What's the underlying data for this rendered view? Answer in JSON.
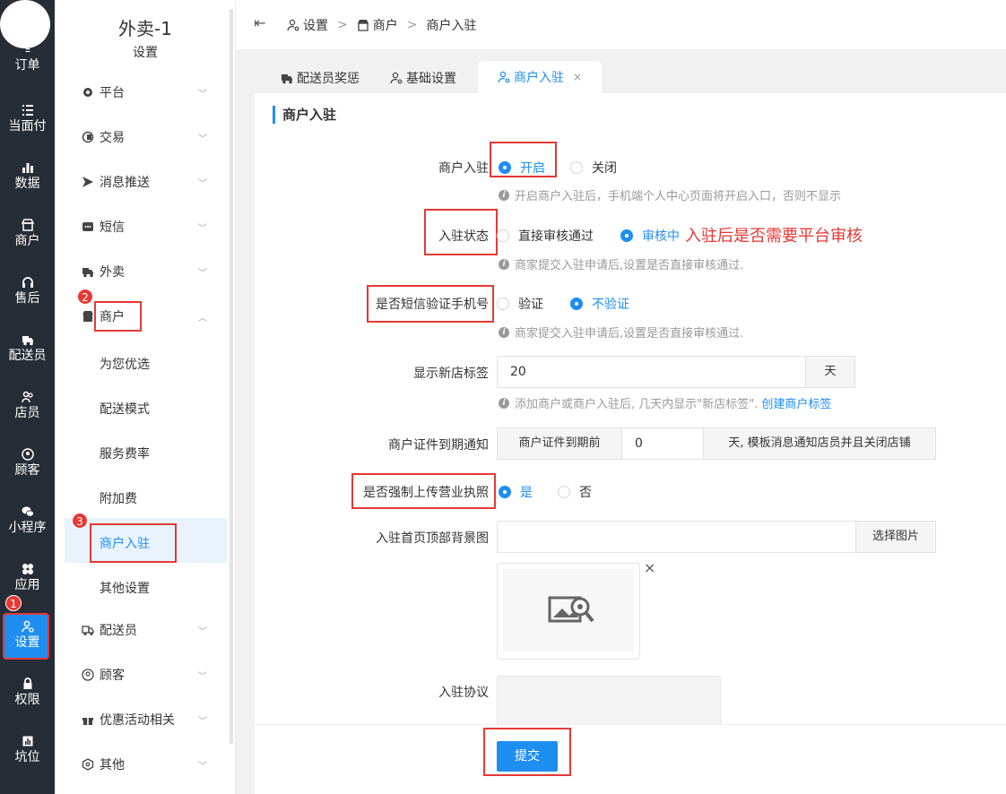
{
  "sidebar": {
    "rail": [
      {
        "label": "订单",
        "icon": "list-icon"
      },
      {
        "label": "当面付",
        "icon": "list-icon"
      },
      {
        "label": "数据",
        "icon": "bar-chart-icon"
      },
      {
        "label": "商户",
        "icon": "store-icon"
      },
      {
        "label": "售后",
        "icon": "headset-icon"
      },
      {
        "label": "配送员",
        "icon": "delivery-truck-icon"
      },
      {
        "label": "店员",
        "icon": "users-icon"
      },
      {
        "label": "顾客",
        "icon": "user-circle-icon"
      },
      {
        "label": "小程序",
        "icon": "wechat-icon"
      },
      {
        "label": "应用",
        "icon": "apps-icon"
      },
      {
        "label": "设置",
        "icon": "user-settings-icon"
      },
      {
        "label": "权限",
        "icon": "lock-icon"
      },
      {
        "label": "坑位",
        "icon": "chart-icon"
      }
    ],
    "app_title": "外卖-1",
    "app_subtitle": "设置",
    "menu": [
      {
        "label": "平台",
        "icon": "gear-icon"
      },
      {
        "label": "交易",
        "icon": "wallet-icon"
      },
      {
        "label": "消息推送",
        "icon": "send-icon"
      },
      {
        "label": "短信",
        "icon": "message-icon"
      },
      {
        "label": "外卖",
        "icon": "delivery-truck-icon"
      },
      {
        "label": "商户",
        "icon": "store-icon"
      }
    ],
    "submenu": [
      "为您优选",
      "配送模式",
      "服务费率",
      "附加费",
      "商户入驻",
      "其他设置"
    ],
    "menu2": [
      {
        "label": "配送员",
        "icon": "delivery-truck-icon"
      },
      {
        "label": "顾客",
        "icon": "user-circle-icon"
      },
      {
        "label": "优惠活动相关",
        "icon": "gift-icon"
      },
      {
        "label": "其他",
        "icon": "hexagon-icon"
      }
    ],
    "badges": [
      "1",
      "2",
      "3"
    ]
  },
  "header": {
    "breadcrumb": [
      "设置",
      "商户",
      "商户入驻"
    ],
    "separator": ">"
  },
  "tabs": [
    {
      "label": "配送员奖惩"
    },
    {
      "label": "基础设置"
    },
    {
      "label": "商户入驻",
      "close": "×"
    }
  ],
  "form": {
    "section_title": "商户入驻",
    "merchant_entry": {
      "label": "商户入驻",
      "options": [
        "开启",
        "关闭"
      ],
      "help": "开启商户入驻后，手机端个人中心页面将开启入口，否则不显示"
    },
    "entry_status": {
      "label": "入驻状态",
      "options": [
        "直接审核通过",
        "审核中"
      ],
      "annotation": "入驻后是否需要平台审核",
      "help": "商家提交入驻申请后,设置是否直接审核通过."
    },
    "sms_verify": {
      "label": "是否短信验证手机号",
      "options": [
        "验证",
        "不验证"
      ],
      "help": "商家提交入驻申请后,设置是否直接审核通过."
    },
    "new_store_tag": {
      "label": "显示新店标签",
      "value": "20",
      "suffix": "天",
      "help": "添加商户或商户入驻后, 几天内显示\"新店标签\".",
      "help_link": "创建商户标签"
    },
    "cert_expiry": {
      "label": "商户证件到期通知",
      "prefix": "商户证件到期前",
      "value": "0",
      "suffix": "天, 模板消息通知店员并且关闭店铺"
    },
    "force_license": {
      "label": "是否强制上传营业执照",
      "options": [
        "是",
        "否"
      ]
    },
    "bg_image": {
      "label": "入驻首页顶部背景图",
      "value": "",
      "button": "选择图片",
      "remove": "×"
    },
    "agreement": {
      "label": "入驻协议"
    },
    "submit": "提交"
  },
  "colors": {
    "accent": "#1f8ef1",
    "annotation_red": "#e53935",
    "rail_bg": "#272d37"
  }
}
